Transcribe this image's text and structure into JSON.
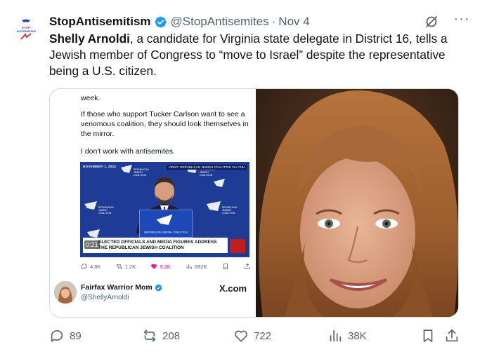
{
  "author": {
    "display_name": "StopAntisemitism",
    "handle": "@StopAntisemites",
    "separator": "·",
    "date": "Nov 4",
    "verified": true,
    "logo_text_top": "STOP",
    "logo_text_bottom": "ANTISEMITISM"
  },
  "tweet": {
    "bold_name": "Shelly Arnoldi",
    "text_rest": ", a candidate for Virginia state delegate in District 16, tells a Jewish member of Congress to “move to Israel” despite the representative being a U.S. citizen."
  },
  "embedded_post": {
    "line1": "week.",
    "line2": "If those who support Tucker Carlson want to see a venomous coalition, they should look themselves in the mirror.",
    "line3": "I don't work with antisemites.",
    "video": {
      "date_label": "NOVEMBER 1, 2024",
      "top_right_label": "VIDEO: REPUBLICAN JEWISH COALITION VIA CNN",
      "caption": "ELECTED OFFICIALS AND MEDIA FIGURES ADDRESS THE REPUBLICAN JEWISH COALITION",
      "time": "0:21",
      "banner_text": "REPUBLICAN JEWISH COALITION"
    },
    "stats": {
      "replies": "4.8K",
      "reposts": "1.2K",
      "likes": "9.2K",
      "views": "692K"
    },
    "author_name": "Fairfax Warrior Mom",
    "author_handle": "@ShellyArnoldi",
    "source": "X.com"
  },
  "actions": {
    "replies": "89",
    "reposts": "208",
    "likes": "722",
    "views": "38K"
  },
  "colors": {
    "text": "#0f1419",
    "muted": "#536471",
    "verified": "#1d9bf0",
    "like": "#f91880",
    "border": "#cfd9de"
  },
  "icons": [
    "grok-icon",
    "more-icon",
    "reply-icon",
    "repost-icon",
    "like-icon",
    "views-icon",
    "bookmark-icon",
    "share-icon",
    "verified-badge-icon"
  ]
}
